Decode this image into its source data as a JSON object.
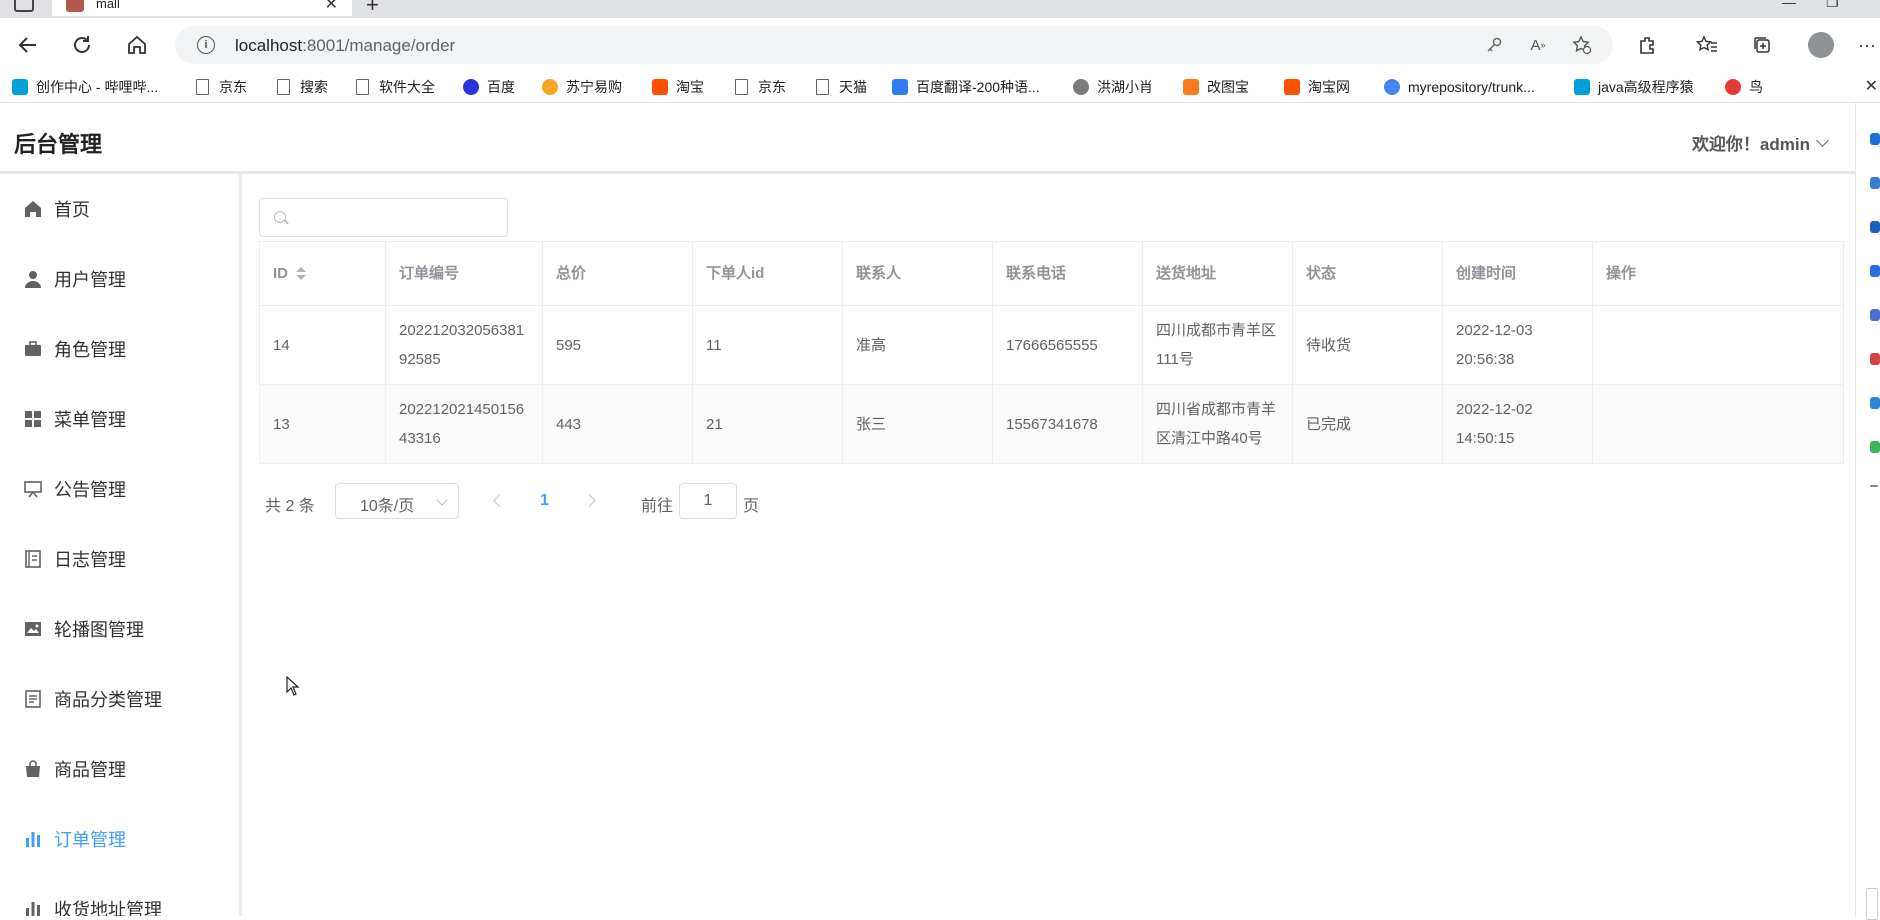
{
  "browser": {
    "tab_title": "mall",
    "url_host": "localhost",
    "url_path": ":8001/manage/order",
    "bookmarks": [
      {
        "label": "创作中心 - 哔哩哔...",
        "icon": "bilibili-icon",
        "color": "#00a1d6"
      },
      {
        "label": "京东",
        "icon": "page-icon",
        "color": ""
      },
      {
        "label": "搜索",
        "icon": "page-icon",
        "color": ""
      },
      {
        "label": "软件大全",
        "icon": "page-icon",
        "color": ""
      },
      {
        "label": "百度",
        "icon": "baidu-icon",
        "color": "#2932e1"
      },
      {
        "label": "苏宁易购",
        "icon": "suning-icon",
        "color": "#f5a623"
      },
      {
        "label": "淘宝",
        "icon": "taobao-icon",
        "color": "#ff5000"
      },
      {
        "label": "京东",
        "icon": "page-icon",
        "color": ""
      },
      {
        "label": "天猫",
        "icon": "page-icon",
        "color": ""
      },
      {
        "label": "百度翻译-200种语...",
        "icon": "translate-icon",
        "color": "#2f7cf6"
      },
      {
        "label": "洪湖小肖",
        "icon": "bird-icon",
        "color": "#7a7a7a"
      },
      {
        "label": "改图宝",
        "icon": "gaitubao-icon",
        "color": "#ff7a1a"
      },
      {
        "label": "淘宝网",
        "icon": "taobao-icon",
        "color": "#ff5000"
      },
      {
        "label": "myrepository/trunk...",
        "icon": "chrome-icon",
        "color": "#4285f4"
      },
      {
        "label": "java高级程序猿",
        "icon": "bilibili-icon",
        "color": "#00a1d6"
      },
      {
        "label": "鸟",
        "icon": "bird-icon",
        "color": "#e53935"
      }
    ]
  },
  "app": {
    "title": "后台管理",
    "welcome": "欢迎你！admin",
    "accent_color": "#409eff"
  },
  "sidebar": {
    "items": [
      {
        "label": "首页",
        "icon": "home-icon",
        "active": false
      },
      {
        "label": "用户管理",
        "icon": "user-icon",
        "active": false
      },
      {
        "label": "角色管理",
        "icon": "briefcase-icon",
        "active": false
      },
      {
        "label": "菜单管理",
        "icon": "grid-icon",
        "active": false
      },
      {
        "label": "公告管理",
        "icon": "notice-board-icon",
        "active": false
      },
      {
        "label": "日志管理",
        "icon": "notebook-icon",
        "active": false
      },
      {
        "label": "轮播图管理",
        "icon": "image-icon",
        "active": false
      },
      {
        "label": "商品分类管理",
        "icon": "document-icon",
        "active": false
      },
      {
        "label": "商品管理",
        "icon": "shopping-bag-icon",
        "active": false
      },
      {
        "label": "订单管理",
        "icon": "bar-chart-icon",
        "active": true
      },
      {
        "label": "收货地址管理",
        "icon": "bar-chart-icon",
        "active": false
      }
    ]
  },
  "search": {
    "placeholder": "",
    "value": ""
  },
  "table": {
    "columns": [
      "ID",
      "订单编号",
      "总价",
      "下单人id",
      "联系人",
      "联系电话",
      "送货地址",
      "状态",
      "创建时间",
      "操作"
    ],
    "rows": [
      [
        "14",
        "20221203205638192585",
        "595",
        "11",
        "准高",
        "17666565555",
        "四川成都市青羊区111号",
        "待收货",
        "2022-12-03 20:56:38",
        ""
      ],
      [
        "13",
        "20221202145015643316",
        "443",
        "21",
        "张三",
        "15567341678",
        "四川省成都市青羊区清江中路40号",
        "已完成",
        "2022-12-02 14:50:15",
        ""
      ]
    ]
  },
  "pagination": {
    "total": "共 2 条",
    "page_size": "10条/页",
    "current_page": "1",
    "goto_label": "前往",
    "goto_value": "1",
    "page_suffix": "页"
  }
}
